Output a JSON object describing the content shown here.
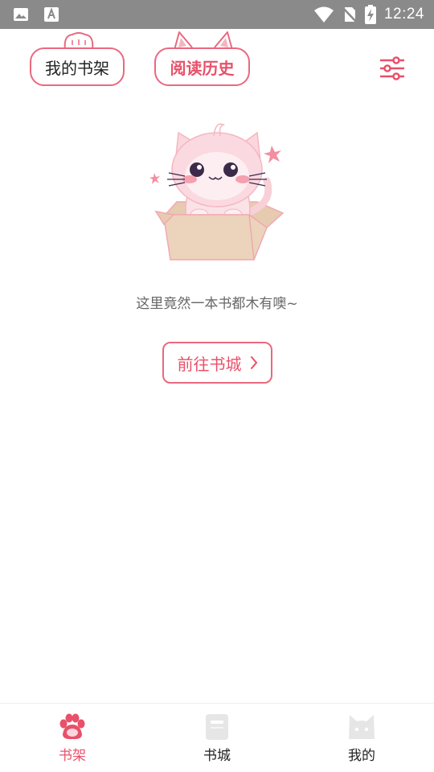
{
  "status_bar": {
    "time": "12:24",
    "icons": [
      "image-icon",
      "text-a-icon",
      "wifi-icon",
      "no-sim-icon",
      "battery-charging-icon"
    ]
  },
  "header": {
    "tabs": [
      {
        "label": "我的书架",
        "active": false
      },
      {
        "label": "阅读历史",
        "active": true
      }
    ],
    "filter_icon": "sliders-icon"
  },
  "empty_state": {
    "illustration": "cat-in-box",
    "message": "这里竟然一本书都木有噢~",
    "button_label": "前往书城"
  },
  "bottom_nav": {
    "items": [
      {
        "label": "书架",
        "icon": "paw-icon",
        "active": true
      },
      {
        "label": "书城",
        "icon": "book-icon",
        "active": false
      },
      {
        "label": "我的",
        "icon": "cat-face-icon",
        "active": false
      }
    ]
  },
  "colors": {
    "accent": "#e9506a",
    "border": "#e9697f",
    "status_bar": "#8a8a8a",
    "inactive_icon": "#e6e6e6"
  }
}
